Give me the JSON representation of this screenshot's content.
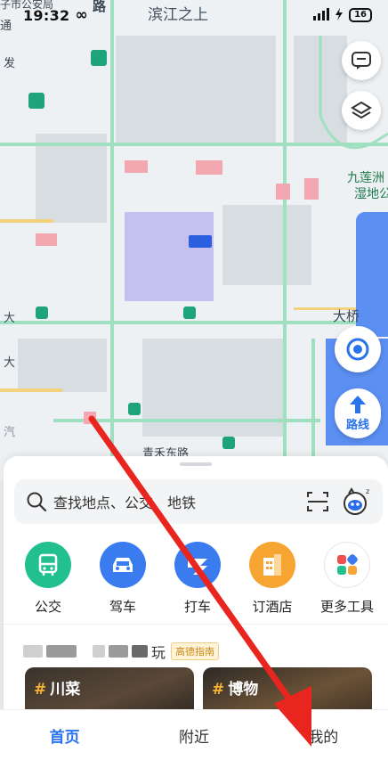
{
  "status_bar": {
    "time": "19:32",
    "infinity": "∞",
    "battery": "16"
  },
  "map": {
    "labels": {
      "top_center": "滨江之上",
      "top_left_1": "子市公安局",
      "top_left_2": "通",
      "top_left_3": "发",
      "road_top": "路",
      "wetland_1": "九莲洲",
      "wetland_2": "湿地公",
      "bridge": "大桥",
      "left_1": "大",
      "left_2": "大",
      "left_3": "汽",
      "road_bottom": "青禾东路"
    },
    "route_label": "路线"
  },
  "search": {
    "placeholder": "查找地点、公交、地铁"
  },
  "tools": [
    {
      "label": "公交",
      "icon": "bus-icon",
      "color": "#22c08f"
    },
    {
      "label": "驾车",
      "icon": "car-icon",
      "color": "#3a7bf0"
    },
    {
      "label": "打车",
      "icon": "taxi-icon",
      "color": "#3a7bf0"
    },
    {
      "label": "订酒店",
      "icon": "hotel-icon",
      "color": "#f6a533"
    },
    {
      "label": "更多工具",
      "icon": "more-tools-icon",
      "color": "#ffffff"
    }
  ],
  "guide": {
    "title_suffix": "玩",
    "badge": "高德指南"
  },
  "cards": [
    {
      "title": "川菜"
    },
    {
      "title": "博物"
    }
  ],
  "tabs": {
    "home": "首页",
    "nearby": "附近",
    "mine": "我的"
  },
  "colors": {
    "accent": "#2a73ee",
    "arrow": "#e8261f"
  }
}
